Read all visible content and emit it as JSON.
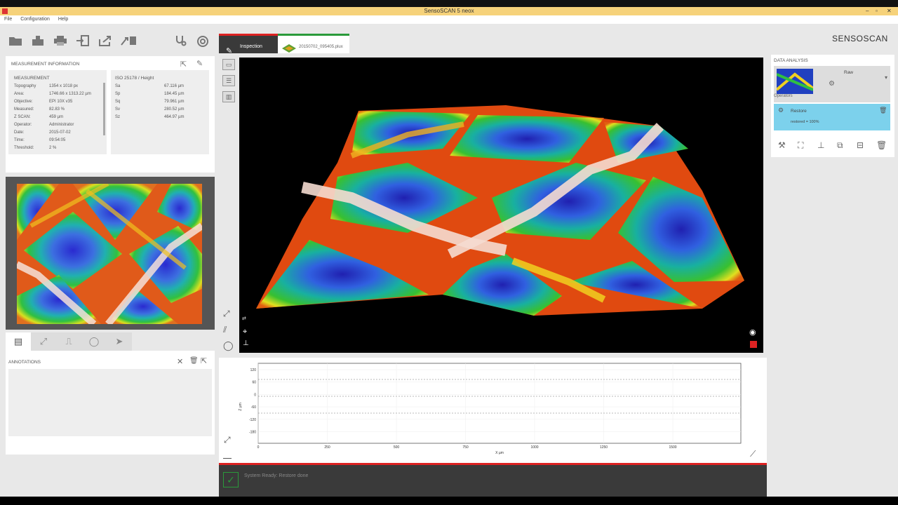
{
  "window": {
    "title": "SensoSCAN 5 neox"
  },
  "menu": [
    "File",
    "Configuration",
    "Help"
  ],
  "brand": {
    "logo_text": "SENSOSCAN"
  },
  "toolbar_icons": [
    "folder-icon",
    "save-icon",
    "print-icon",
    "import-icon",
    "export-icon",
    "batch-icon",
    "stethoscope-icon",
    "lifebuoy-icon"
  ],
  "measurement_info": {
    "title": "MEASUREMENT INFORMATION",
    "section": "MEASUREMENT",
    "rows": [
      {
        "label": "Topography",
        "value": "1354 x 1018 px"
      },
      {
        "label": "Area:",
        "value": "1746.66 x 1313.22 µm"
      },
      {
        "label": "Objective:",
        "value": "EPI 10X v35"
      },
      {
        "label": "Measured:",
        "value": "82.83 %"
      },
      {
        "label": "Z SCAN:",
        "value": "459 µm"
      },
      {
        "label": "Operator:",
        "value": "Administrator"
      },
      {
        "label": "Date:",
        "value": "2015-07-02"
      },
      {
        "label": "Time:",
        "value": "09:54:05"
      },
      {
        "label": "Threshold:",
        "value": "2 %"
      }
    ],
    "iso_title": "ISO 25178 / Height",
    "iso_rows": [
      {
        "label": "Sa",
        "value": "67.116",
        "unit": "µm"
      },
      {
        "label": "Sp",
        "value": "184.45",
        "unit": "µm"
      },
      {
        "label": "Sq",
        "value": "79.961",
        "unit": "µm"
      },
      {
        "label": "Sv",
        "value": "280.52",
        "unit": "µm"
      },
      {
        "label": "Sz",
        "value": "464.97",
        "unit": "µm"
      }
    ]
  },
  "annotations": {
    "title": "ANNOTATIONS"
  },
  "view_tabs": {
    "inspection": "Inspection",
    "file": "20150702_095405.plux"
  },
  "profile": {
    "y_label": "Z µm",
    "x_label": "X µm",
    "y_ticks": [
      "120",
      "60",
      "0",
      "-60",
      "-120",
      "-180"
    ],
    "x_ticks": [
      "0",
      "250",
      "500",
      "750",
      "1000",
      "1250",
      "1500"
    ]
  },
  "status": {
    "text": "System Ready: Restore done"
  },
  "data_analysis": {
    "title": "DATA ANALYSIS",
    "raw_label": "Raw",
    "operators_label": "Operators",
    "restore_label": "Restore",
    "restore_detail": "restored = 100%"
  },
  "colors": {
    "accent_red": "#d22",
    "accent_green": "#2a9a3a",
    "restore_bg": "#7cd1ec"
  }
}
